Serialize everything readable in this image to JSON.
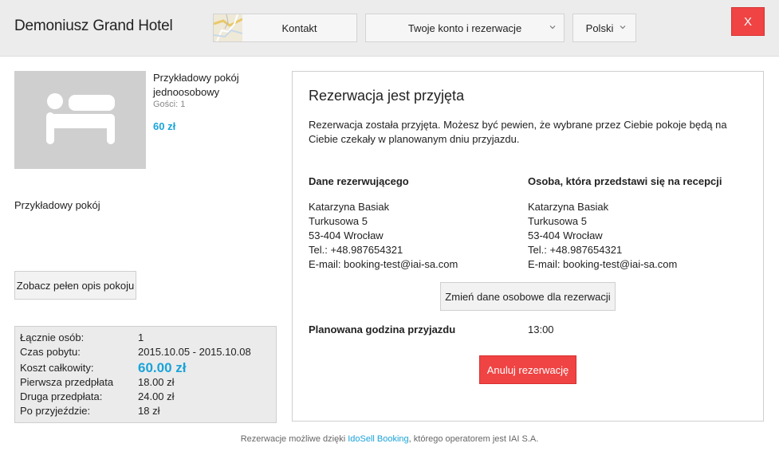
{
  "header": {
    "hotel_name": "Demoniusz Grand Hotel",
    "contact_label": "Kontakt",
    "account_label": "Twoje konto i rezerwacje",
    "language_label": "Polski",
    "close_label": "X"
  },
  "room": {
    "name": "Przykładowy pokój jednoosobowy",
    "guests": "Gości: 1",
    "price": "60 zł",
    "description": "Przykładowy pokój",
    "details_button": "Zobacz pełen opis pokoju"
  },
  "summary": {
    "rows": [
      {
        "label": "Łącznie osób:",
        "value": "1"
      },
      {
        "label": "Czas pobytu:",
        "value": "2015.10.05 - 2015.10.08"
      },
      {
        "label": "Koszt całkowity:",
        "value": "60.00 zł"
      },
      {
        "label": "Pierwsza przedpłata",
        "value": "18.00 zł"
      },
      {
        "label": "Druga przedpłata:",
        "value": "24.00 zł"
      },
      {
        "label": "Po przyjeździe:",
        "value": "18 zł"
      }
    ]
  },
  "confirmation": {
    "title": "Rezerwacja jest przyjęta",
    "message": "Rezerwacja została przyjęta. Możesz być pewien, że wybrane przez Ciebie pokoje będą na Ciebie czekały w planowanym dniu przyjazdu.",
    "booker_heading": "Dane rezerwującego",
    "guest_heading": "Osoba, która przedstawi się na recepcji",
    "booker": {
      "name": "Katarzyna Basiak",
      "street": "Turkusowa 5",
      "city": "53-404 Wrocław",
      "phone": "Tel.: +48.987654321",
      "email": "E-mail: booking-test@iai-sa.com"
    },
    "guest": {
      "name": "Katarzyna Basiak",
      "street": "Turkusowa 5",
      "city": "53-404 Wrocław",
      "phone": "Tel.: +48.987654321",
      "email": "E-mail: booking-test@iai-sa.com"
    },
    "change_button": "Zmień dane osobowe dla rezerwacji",
    "arrival_label": "Planowana godzina przyjazdu",
    "arrival_value": "13:00",
    "cancel_button": "Anuluj rezerwację"
  },
  "footer": {
    "prefix": "Rezerwacje możliwe dzięki ",
    "link": "IdoSell Booking",
    "suffix": ", którego operatorem jest IAI S.A."
  },
  "colors": {
    "accent_blue": "#1aa3d9",
    "danger_red": "#f04343",
    "header_bg": "#ececec"
  },
  "icons": {
    "room_placeholder": "bed-icon",
    "map": "map-icon"
  }
}
